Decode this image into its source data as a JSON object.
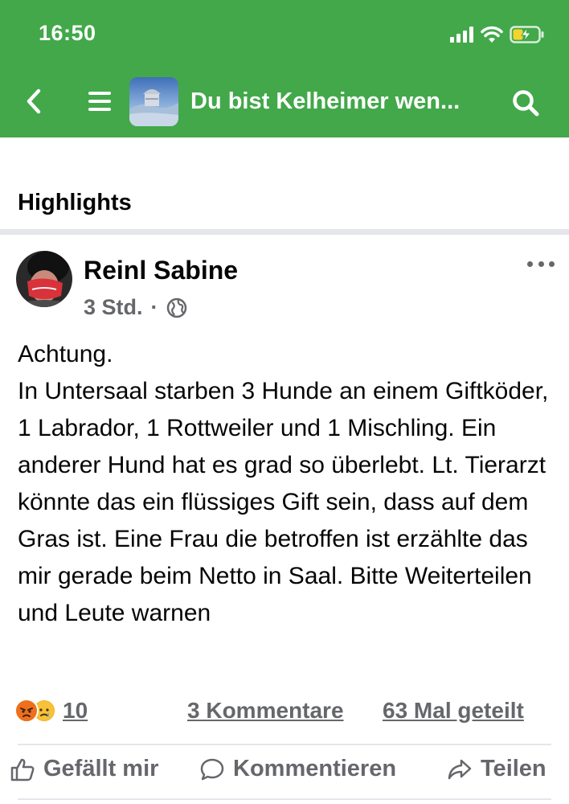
{
  "status_bar": {
    "time": "16:50"
  },
  "header": {
    "group_title": "Du bist Kelheimer wen...",
    "back_icon": "chevron-left-icon",
    "menu_icon": "hamburger-menu-icon",
    "search_icon": "search-icon"
  },
  "section": {
    "title": "Highlights"
  },
  "post": {
    "author": "Reinl Sabine",
    "time": "3 Std.",
    "separator": "·",
    "audience_icon": "globe-icon",
    "text": "Achtung.\nIn Untersaal starben 3 Hunde an einem Giftköder, 1 Labrador, 1 Rottweiler und 1 Mischling. Ein anderer Hund hat es grad so überlebt. Lt. Tierarzt könnte das ein flüssiges Gift sein, dass auf dem Gras ist. Eine Frau die betroffen ist erzählte das mir gerade beim Netto in Saal. Bitte Weiterteilen und Leute warnen",
    "reaction_count": "10",
    "comments": "3 Kommentare",
    "shares": "63 Mal geteilt"
  },
  "actions": {
    "like": "Gefällt mir",
    "comment": "Kommentieren",
    "share": "Teilen"
  },
  "colors": {
    "header_green": "#42a84a",
    "secondary_text": "#65676b",
    "divider": "#e4e6eb"
  }
}
